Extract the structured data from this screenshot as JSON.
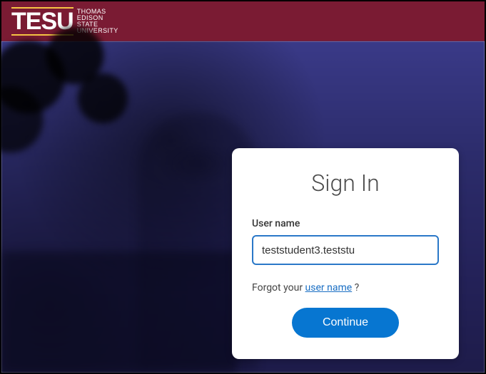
{
  "header": {
    "logo_main": "TESU",
    "logo_sub_1": "THOMAS",
    "logo_sub_2": "EDISON",
    "logo_sub_3": "STATE",
    "logo_sub_4": "UNIVERSITY"
  },
  "card": {
    "title": "Sign In",
    "username_label": "User name",
    "username_value": "teststudent3.teststu",
    "forgot_prefix": "Forgot your ",
    "forgot_link": "user name",
    "forgot_suffix": " ?",
    "continue_label": "Continue"
  }
}
